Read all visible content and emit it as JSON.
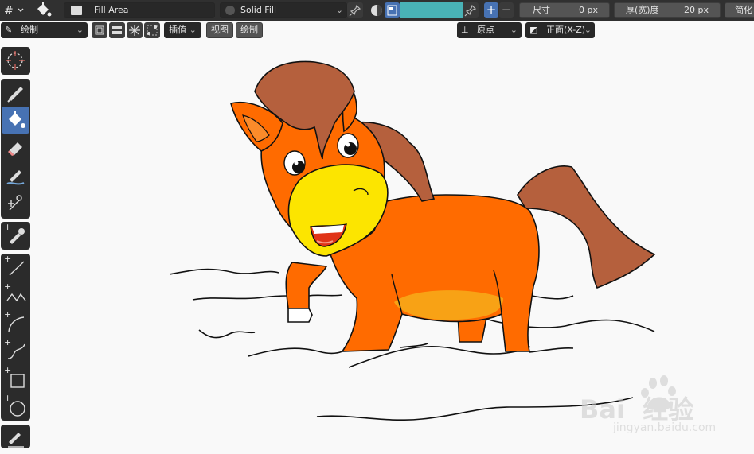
{
  "topbar": {
    "mode_icon": "hash-grid-icon",
    "tool_icon": "bucket-icon",
    "brush_name": "Fill Area",
    "material_name": "Solid Fill",
    "color_hex": "#49b2b6",
    "size_label": "尺寸",
    "size_value": "0 px",
    "thickness_label": "厚(宽)度",
    "thickness_value": "20 px",
    "simplify_label": "简化"
  },
  "header2": {
    "mode_select": "绘制",
    "interp_label": "插值",
    "view_menu": "视图",
    "draw_menu": "绘制",
    "origin_select": "原点",
    "plane_select": "正面(X-Z)"
  },
  "toolbar": {
    "items": [
      {
        "name": "cursor-tool",
        "icon": "cursor-icon"
      },
      {
        "name": "draw-tool",
        "icon": "pencil-icon"
      },
      {
        "name": "fill-tool",
        "icon": "bucket-icon",
        "active": true
      },
      {
        "name": "erase-tool",
        "icon": "eraser-icon"
      },
      {
        "name": "tint-tool",
        "icon": "tint-brush-icon"
      },
      {
        "name": "cutter-tool",
        "icon": "scissors-icon"
      },
      {
        "name": "eyedropper-tool",
        "icon": "eyedropper-icon"
      },
      {
        "name": "line-tool",
        "icon": "line-icon"
      },
      {
        "name": "polyline-tool",
        "icon": "polyline-icon"
      },
      {
        "name": "arc-tool",
        "icon": "arc-icon"
      },
      {
        "name": "curve-tool",
        "icon": "curve-icon"
      },
      {
        "name": "box-tool",
        "icon": "box-icon"
      },
      {
        "name": "circle-tool",
        "icon": "circle-icon"
      },
      {
        "name": "annotate-tool",
        "icon": "annotate-icon"
      }
    ]
  },
  "colors": {
    "header_bg": "#303030",
    "active_tool": "#4772b3",
    "horse_orange": "#ff6b00",
    "mane_brown": "#b5603d",
    "muzzle_yellow": "#fce500",
    "belly": "#f8a215"
  },
  "watermark": {
    "brand_text": "Bai  经验",
    "url": "jingyan.baidu.com"
  }
}
